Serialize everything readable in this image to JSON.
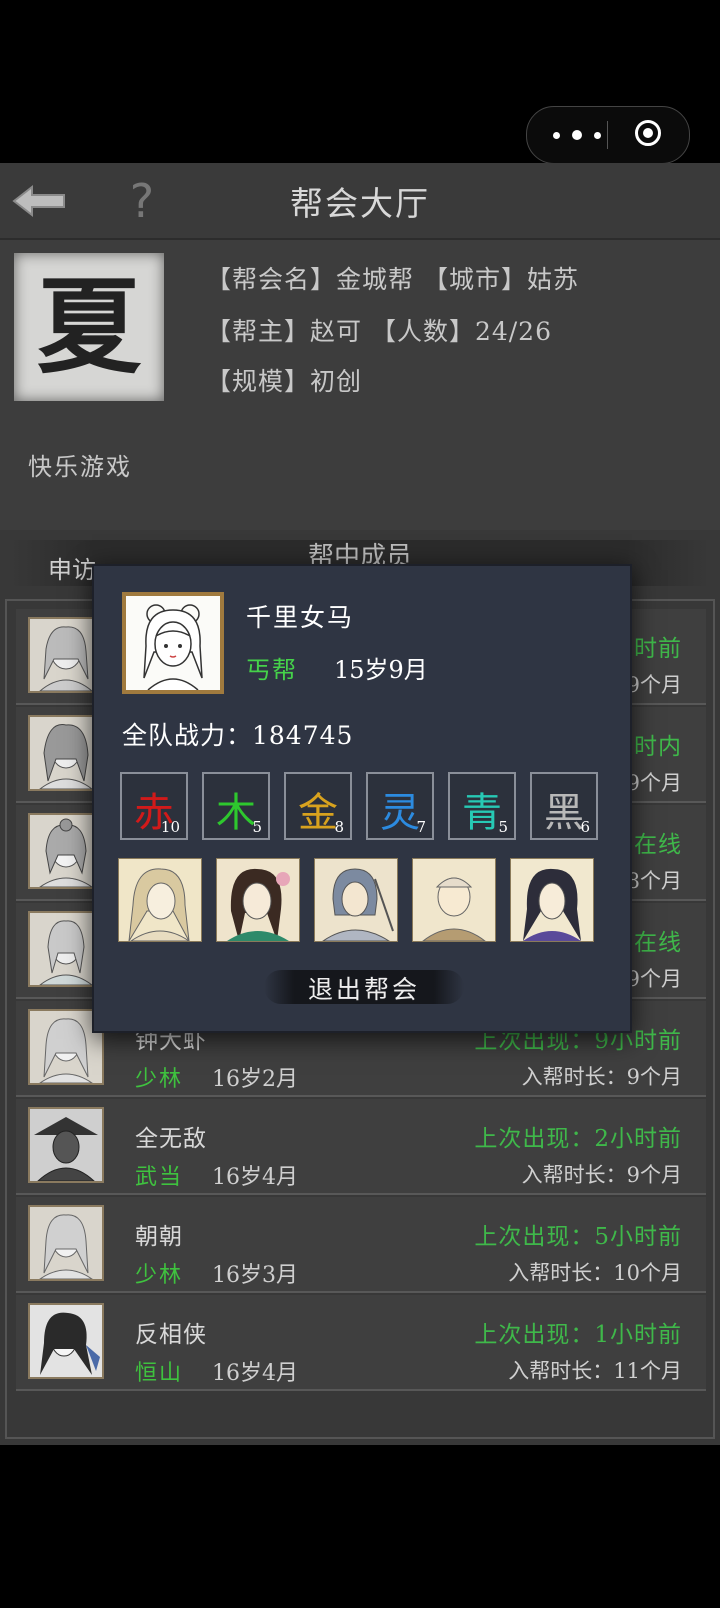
{
  "header": {
    "title": "帮会大厅"
  },
  "guild": {
    "emblem": "夏",
    "line1": "【帮会名】金城帮  【城市】姑苏",
    "line2": "【帮主】赵可 【人数】24/26",
    "line3": "【规模】初创",
    "motto": "快乐游戏"
  },
  "section": {
    "left_fragment": "申访",
    "title": "帮中成员"
  },
  "members": [
    {
      "name": "",
      "sect": "",
      "age": "",
      "last": "时前",
      "join": "9个月"
    },
    {
      "name": "",
      "sect": "",
      "age": "",
      "last": "时内",
      "join": "9个月"
    },
    {
      "name": "",
      "sect": "",
      "age": "",
      "last": "在线",
      "join": "8个月"
    },
    {
      "name": "",
      "sect": "",
      "age": "",
      "last": "在线",
      "join": "9个月"
    },
    {
      "name": "钟大虾",
      "sect": "少林",
      "age": "16岁2月",
      "last": "上次出现：9小时前",
      "join": "入帮时长：9个月"
    },
    {
      "name": "全无敌",
      "sect": "武当",
      "age": "16岁4月",
      "last": "上次出现：2小时前",
      "join": "入帮时长：9个月"
    },
    {
      "name": "朝朝",
      "sect": "少林",
      "age": "16岁3月",
      "last": "上次出现：5小时前",
      "join": "入帮时长：10个月"
    },
    {
      "name": "反相侠",
      "sect": "恒山",
      "age": "16岁4月",
      "last": "上次出现：1小时前",
      "join": "入帮时长：11个月"
    }
  ],
  "popup": {
    "name": "千里女马",
    "sect": "丐帮",
    "age": "15岁9月",
    "power": "全队战力：184745",
    "elements": [
      {
        "char": "赤",
        "count": "10",
        "color": "#d11a1a"
      },
      {
        "char": "木",
        "count": "5",
        "color": "#2ec72e"
      },
      {
        "char": "金",
        "count": "8",
        "color": "#d8a21e"
      },
      {
        "char": "灵",
        "count": "7",
        "color": "#2c8be0"
      },
      {
        "char": "青",
        "count": "5",
        "color": "#27c9b5"
      },
      {
        "char": "黑",
        "count": "6",
        "color": "#b8b8b8"
      }
    ],
    "quit_label": "退出帮会"
  }
}
